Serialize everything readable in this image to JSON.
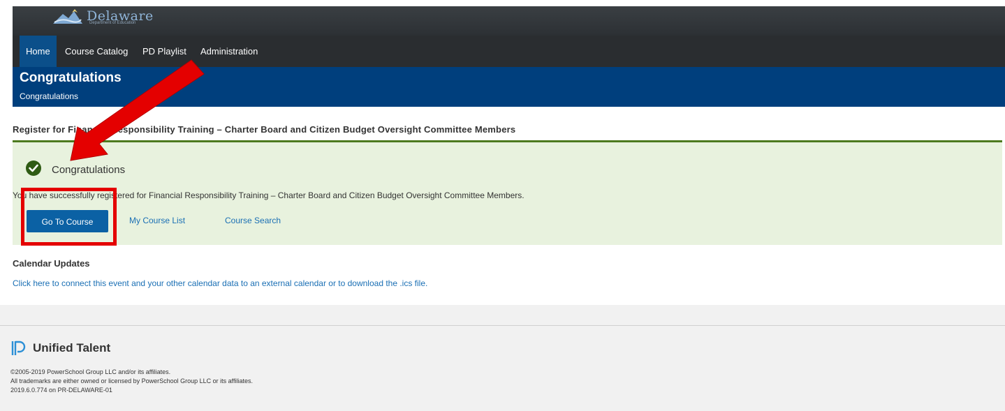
{
  "brand": {
    "name": "Delaware",
    "sub": "Department of Education"
  },
  "nav": {
    "items": [
      {
        "label": "Home"
      },
      {
        "label": "Course Catalog"
      },
      {
        "label": "PD Playlist"
      },
      {
        "label": "Administration"
      }
    ]
  },
  "banner": {
    "title": "Congratulations",
    "subtitle": "Congratulations"
  },
  "registration": {
    "title": "Register for Financial Responsibility Training – Charter Board and Citizen Budget Oversight Committee Members"
  },
  "success": {
    "title": "Congratulations",
    "message": "You have successfully registered for Financial Responsibility Training – Charter Board and Citizen Budget Oversight Committee Members.",
    "go_button": "Go To Course",
    "my_courses": "My Course List",
    "course_search": "Course Search"
  },
  "calendar": {
    "title": "Calendar Updates",
    "link": "Click here to connect this event and your other calendar data to an external calendar or to download the .ics file."
  },
  "footer": {
    "product": "Unified Talent",
    "lines": [
      "©2005-2019 PowerSchool Group LLC and/or its affiliates.",
      "All trademarks are either owned or licensed by PowerSchool Group LLC or its affiliates.",
      "2019.6.0.774 on PR-DELAWARE-01"
    ]
  },
  "colors": {
    "banner": "#003f7d",
    "nav_active": "#0b4f8a",
    "success_bg": "#e8f2de",
    "annotation": "#e40000"
  }
}
